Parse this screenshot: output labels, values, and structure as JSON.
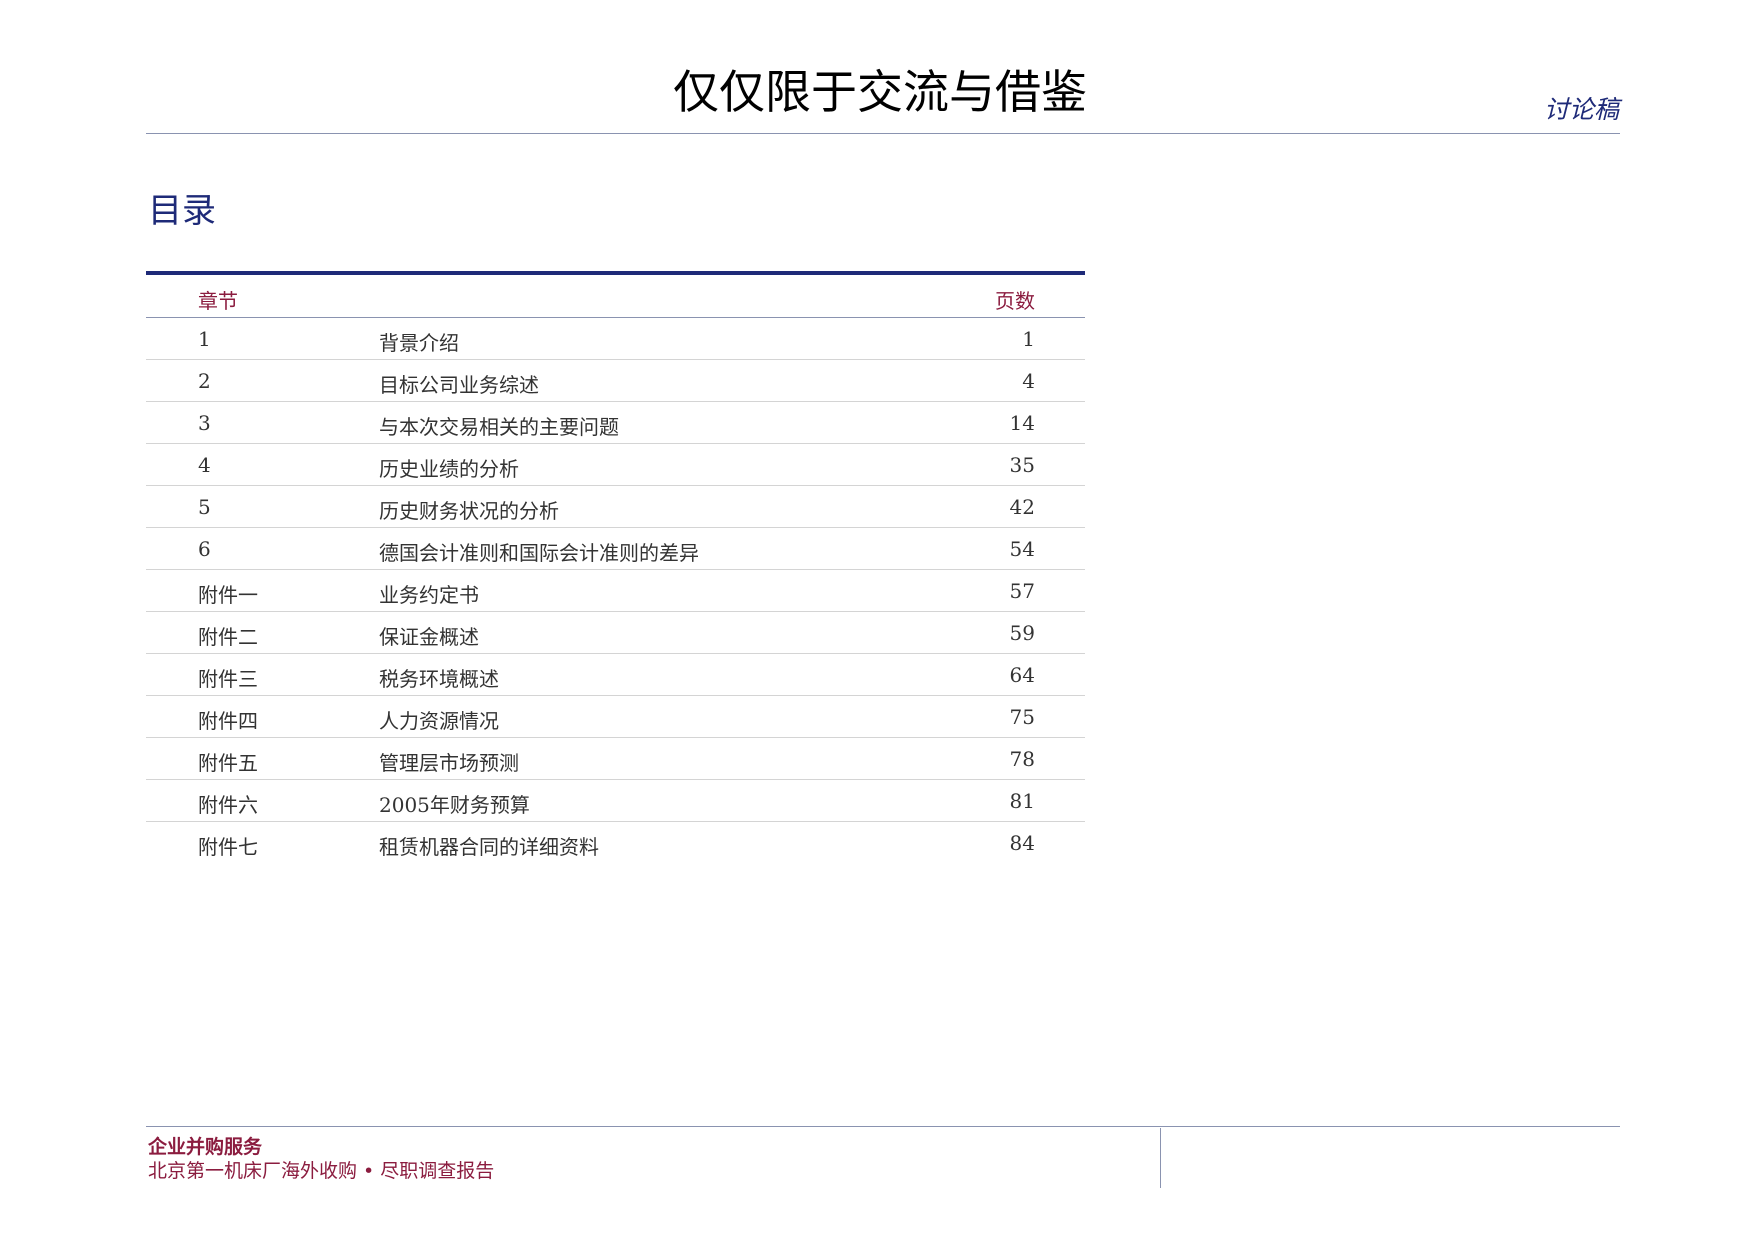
{
  "header": {
    "title": "仅仅限于交流与借鉴",
    "tag": "讨论稿"
  },
  "toc": {
    "heading": "目录",
    "col_chapter": "章节",
    "col_page": "页数",
    "rows": [
      {
        "chapter": "1",
        "title": "背景介绍",
        "page": "1"
      },
      {
        "chapter": "2",
        "title": "目标公司业务综述",
        "page": "4"
      },
      {
        "chapter": "3",
        "title": "与本次交易相关的主要问题",
        "page": "14"
      },
      {
        "chapter": "4",
        "title": "历史业绩的分析",
        "page": "35"
      },
      {
        "chapter": "5",
        "title": "历史财务状况的分析",
        "page": "42"
      },
      {
        "chapter": "6",
        "title": "德国会计准则和国际会计准则的差异",
        "page": "54"
      },
      {
        "chapter": "附件一",
        "title": "业务约定书",
        "page": "57"
      },
      {
        "chapter": "附件二",
        "title": "保证金概述",
        "page": "59"
      },
      {
        "chapter": "附件三",
        "title": "税务环境概述",
        "page": "64"
      },
      {
        "chapter": "附件四",
        "title": "人力资源情况",
        "page": "75"
      },
      {
        "chapter": "附件五",
        "title": "管理层市场预测",
        "page": "78"
      },
      {
        "chapter": "附件六",
        "title": "2005年财务预算",
        "page": "81"
      },
      {
        "chapter": "附件七",
        "title": "租赁机器合同的详细资料",
        "page": "84"
      }
    ]
  },
  "footer": {
    "department": "企业并购服务",
    "subtitle": "北京第一机床厂海外收购 • 尽职调查报告"
  },
  "colors": {
    "navy": "#1e2a78",
    "maroon": "#8b1c3f"
  }
}
